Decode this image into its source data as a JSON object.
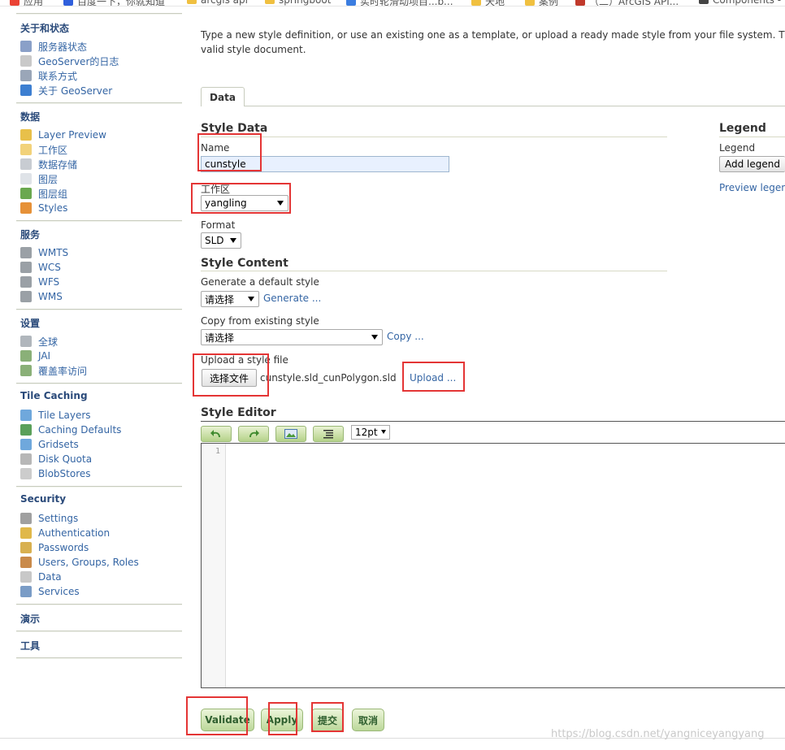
{
  "bookmarks": [
    {
      "label": "应用",
      "color": "#ea4335",
      "icon": "apps-icon"
    },
    {
      "label": "百度一下，你就知道",
      "color": "#2f5fdc",
      "icon": "baidu-icon"
    },
    {
      "label": "arcgis api",
      "color": "#f0c040",
      "icon": "folder-icon"
    },
    {
      "label": "springboot",
      "color": "#f0c040",
      "icon": "folder-icon"
    },
    {
      "label": "实时轮滑动项目...b...",
      "color": "#3b7de0",
      "icon": "site-icon"
    },
    {
      "label": "天地",
      "color": "#f0c040",
      "icon": "folder-icon"
    },
    {
      "label": "案例",
      "color": "#f0c040",
      "icon": "folder-icon"
    },
    {
      "label": "（二）ArcGIS API...",
      "color": "#c0392b",
      "icon": "site-icon"
    },
    {
      "label": "Components -",
      "color": "#444444",
      "icon": "site-icon"
    }
  ],
  "sidebar": {
    "sections": [
      {
        "title": "关于和状态",
        "items": [
          {
            "label": "服务器状态",
            "icon": "server-status-icon",
            "color": "#8aa0c8"
          },
          {
            "label": "GeoServer的日志",
            "icon": "log-icon",
            "color": "#c9c9c9"
          },
          {
            "label": "联系方式",
            "icon": "contact-icon",
            "color": "#9aa6b8"
          },
          {
            "label": "关于 GeoServer",
            "icon": "info-icon",
            "color": "#3d7fd1"
          }
        ]
      },
      {
        "title": "数据",
        "items": [
          {
            "label": "Layer Preview",
            "icon": "layer-preview-icon",
            "color": "#e8c04a"
          },
          {
            "label": "工作区",
            "icon": "folder-icon",
            "color": "#f2d27a"
          },
          {
            "label": "数据存储",
            "icon": "database-icon",
            "color": "#c8ccd2"
          },
          {
            "label": "图层",
            "icon": "layer-icon",
            "color": "#dfe3e8"
          },
          {
            "label": "图层组",
            "icon": "layergroup-icon",
            "color": "#6aa84f"
          },
          {
            "label": "Styles",
            "icon": "styles-icon",
            "color": "#e69138"
          }
        ]
      },
      {
        "title": "服务",
        "items": [
          {
            "label": "WMTS",
            "icon": "wmts-icon",
            "color": "#9aa0a6"
          },
          {
            "label": "WCS",
            "icon": "wcs-icon",
            "color": "#9aa0a6"
          },
          {
            "label": "WFS",
            "icon": "wfs-icon",
            "color": "#9aa0a6"
          },
          {
            "label": "WMS",
            "icon": "wms-icon",
            "color": "#9aa0a6"
          }
        ]
      },
      {
        "title": "设置",
        "items": [
          {
            "label": "全球",
            "icon": "global-icon",
            "color": "#b0b6bc"
          },
          {
            "label": "JAI",
            "icon": "jai-icon",
            "color": "#8ab078"
          },
          {
            "label": "覆盖率访问",
            "icon": "coverage-icon",
            "color": "#8ab078"
          }
        ]
      },
      {
        "title": "Tile Caching",
        "items": [
          {
            "label": "Tile Layers",
            "icon": "tile-layers-icon",
            "color": "#6fa8dc"
          },
          {
            "label": "Caching Defaults",
            "icon": "globe-icon",
            "color": "#5aa05a"
          },
          {
            "label": "Gridsets",
            "icon": "grid-icon",
            "color": "#6fa8dc"
          },
          {
            "label": "Disk Quota",
            "icon": "disk-icon",
            "color": "#b7b7b7"
          },
          {
            "label": "BlobStores",
            "icon": "blobstore-icon",
            "color": "#cccccc"
          }
        ]
      },
      {
        "title": "Security",
        "items": [
          {
            "label": "Settings",
            "icon": "wrench-icon",
            "color": "#a0a0a0"
          },
          {
            "label": "Authentication",
            "icon": "shield-icon",
            "color": "#e0b84a"
          },
          {
            "label": "Passwords",
            "icon": "key-icon",
            "color": "#d8b050"
          },
          {
            "label": "Users, Groups, Roles",
            "icon": "users-icon",
            "color": "#c98a4a"
          },
          {
            "label": "Data",
            "icon": "data-icon",
            "color": "#c8c8c8"
          },
          {
            "label": "Services",
            "icon": "services-icon",
            "color": "#7a9cc6"
          }
        ]
      },
      {
        "title": "演示",
        "items": []
      },
      {
        "title": "工具",
        "items": []
      }
    ]
  },
  "main": {
    "intro_line1": "Type a new style definition, or use an existing one as a template, or upload a ready made style from your file system. The editor can pr",
    "intro_line2": "valid style document.",
    "tab_data": "Data",
    "style_data_heading": "Style Data",
    "name_label": "Name",
    "name_value": "cunstyle",
    "workspace_label": "工作区",
    "workspace_value": "yangling",
    "format_label": "Format",
    "format_value": "SLD",
    "style_content_heading": "Style Content",
    "generate_label": "Generate a default style",
    "generate_select": "请选择",
    "generate_link": "Generate ...",
    "copy_label": "Copy from existing style",
    "copy_select": "请选择",
    "copy_link": "Copy ...",
    "upload_label": "Upload a style file",
    "choose_file_button": "选择文件",
    "file_name": "cunstyle.sld_cunPolygon.sld",
    "upload_link": "Upload ...",
    "legend_heading": "Legend",
    "legend_label": "Legend",
    "add_legend_button": "Add legend",
    "preview_legend_link": "Preview legend",
    "style_editor_heading": "Style Editor",
    "font_size": "12pt",
    "editor_line_number": "1"
  },
  "toolbar_icons": [
    "undo-icon",
    "redo-icon",
    "image-icon",
    "format-icon"
  ],
  "actions": {
    "validate": "Validate",
    "apply": "Apply",
    "submit": "提交",
    "cancel": "取消"
  },
  "watermark": "https://blog.csdn.net/yangniceyangyang",
  "colors": {
    "link": "#3465a4",
    "highlight": "#e43535",
    "button_green": "#bcd89a"
  }
}
